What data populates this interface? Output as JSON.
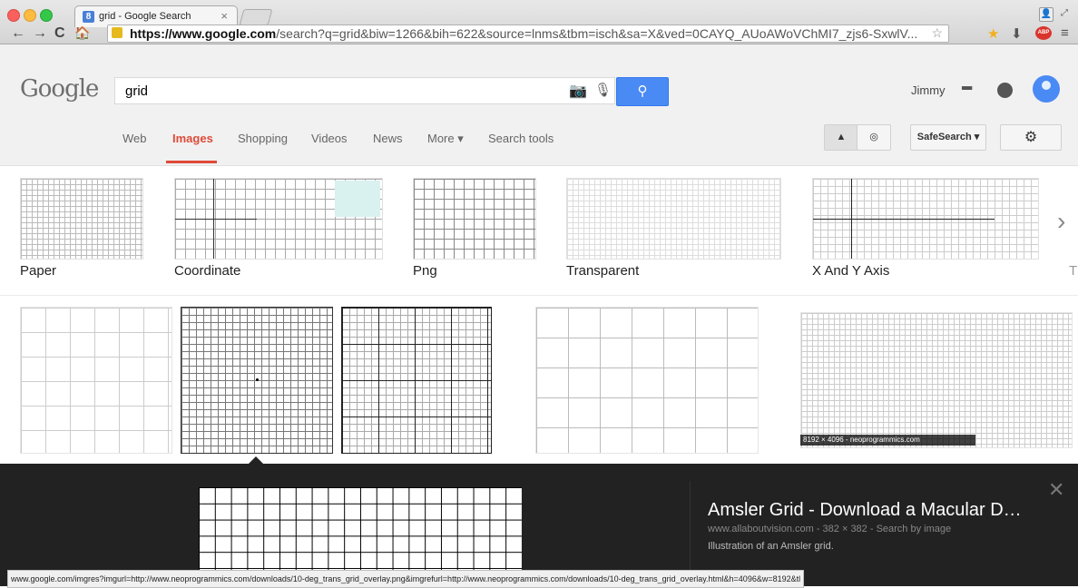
{
  "browser": {
    "tab_title": "grid - Google Search",
    "tab_favicon": "8",
    "tab_close": "×",
    "url_host": "https://www.google.com",
    "url_path": "/search?q=grid&biw=1266&bih=622&source=lnms&tbm=isch&sa=X&ved=0CAYQ_AUoAWoVChMI7_zjs6-SxwlV...",
    "back_glyph": "←",
    "forward_glyph": "→",
    "reload_glyph": "C",
    "home_glyph": "🏠",
    "star_glyph": "☆",
    "abp_label": "ABP",
    "menu_glyph": "≡"
  },
  "google": {
    "logo_text": "Google",
    "query": "grid",
    "search_glyph": "⚲",
    "user_name": "Jimmy",
    "tabs": [
      "Web",
      "Images",
      "Shopping",
      "Videos",
      "News",
      "More ▾",
      "Search tools"
    ],
    "active_tab": "Images",
    "safesearch_label": "SafeSearch ▾",
    "settings_glyph": "⚙"
  },
  "related": [
    {
      "label": "Paper"
    },
    {
      "label": "Coordinate"
    },
    {
      "label": "Png"
    },
    {
      "label": "Transparent"
    },
    {
      "label": "X And Y Axis"
    },
    {
      "label": "T"
    }
  ],
  "results": {
    "caption": "8192 × 4096 - neoprogrammics.com"
  },
  "panel": {
    "title": "Amsler Grid - Download a Macular D…",
    "meta": "www.allaboutvision.com - 382 × 382 - Search by image",
    "description": "Illustration of an Amsler grid.",
    "close_glyph": "✕"
  },
  "status_url": "www.google.com/imgres?imgurl=http://www.neoprogrammics.com/downloads/10-deg_trans_grid_overlay.png&imgrefurl=http://www.neoprogrammics.com/downloads/10-deg_trans_grid_overlay.html&h=4096&w=8192&tl"
}
